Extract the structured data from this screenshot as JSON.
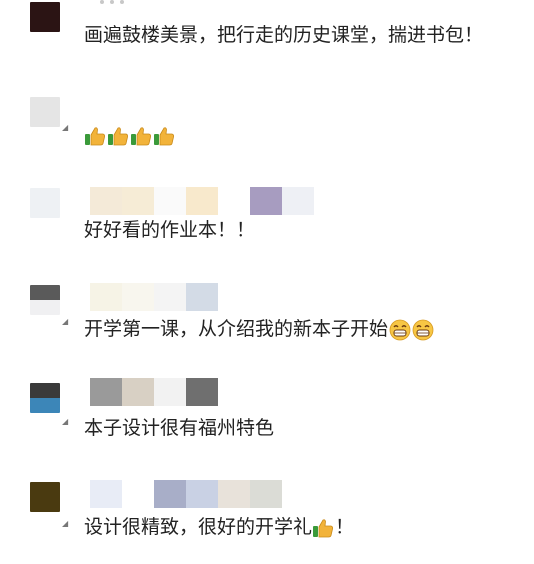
{
  "comments": [
    {
      "text": "画遍鼓楼美景，把行走的历史课堂，揣进书包！",
      "avatar_colors": [
        "#2b1414"
      ],
      "name_mosaic_colors": [],
      "emoji_before": 0,
      "emoji_after_thumbs": 0,
      "emoji_after_grin": 0
    },
    {
      "text": "",
      "avatar_colors": [
        "#e5e5e5"
      ],
      "name_mosaic_colors": [],
      "emoji_before": 4,
      "emoji_after_thumbs": 0,
      "emoji_after_grin": 0
    },
    {
      "text": "好好看的作业本！！",
      "avatar_colors": [
        "#eef1f4"
      ],
      "name_mosaic_colors": [
        "#f4ead8",
        "#f6ecd6",
        "#fafafa",
        "#f8e9cc",
        "#ffffff",
        "#a79cc0",
        "#eef0f5"
      ],
      "emoji_before": 0,
      "emoji_after_thumbs": 0,
      "emoji_after_grin": 0
    },
    {
      "text": "开学第一课，从介绍我的新本子开始",
      "avatar_colors": [
        "#5a5a5a",
        "#f0f0f2"
      ],
      "name_mosaic_colors": [
        "#f6f3e6",
        "#f8f6ee",
        "#f4f4f4",
        "#d3dbe6"
      ],
      "emoji_before": 0,
      "emoji_after_thumbs": 0,
      "emoji_after_grin": 2
    },
    {
      "text": "本子设计很有福州特色",
      "avatar_colors": [
        "#3a3a3a",
        "#3c86b8"
      ],
      "name_mosaic_colors": [
        "#9a9a9a",
        "#d8d0c4",
        "#f2f2f2",
        "#6f6f6f"
      ],
      "emoji_before": 0,
      "emoji_after_thumbs": 0,
      "emoji_after_grin": 0
    },
    {
      "text": "设计很精致，很好的开学礼",
      "text_suffix": "！",
      "avatar_colors": [
        "#4a3a10"
      ],
      "name_mosaic_colors": [
        "#e8ecf6",
        "#ffffff",
        "#a8aec8",
        "#c9d1e4",
        "#e8e2da",
        "#dbdcd6"
      ],
      "emoji_before": 0,
      "emoji_after_thumbs": 1,
      "emoji_after_grin": 0
    }
  ]
}
